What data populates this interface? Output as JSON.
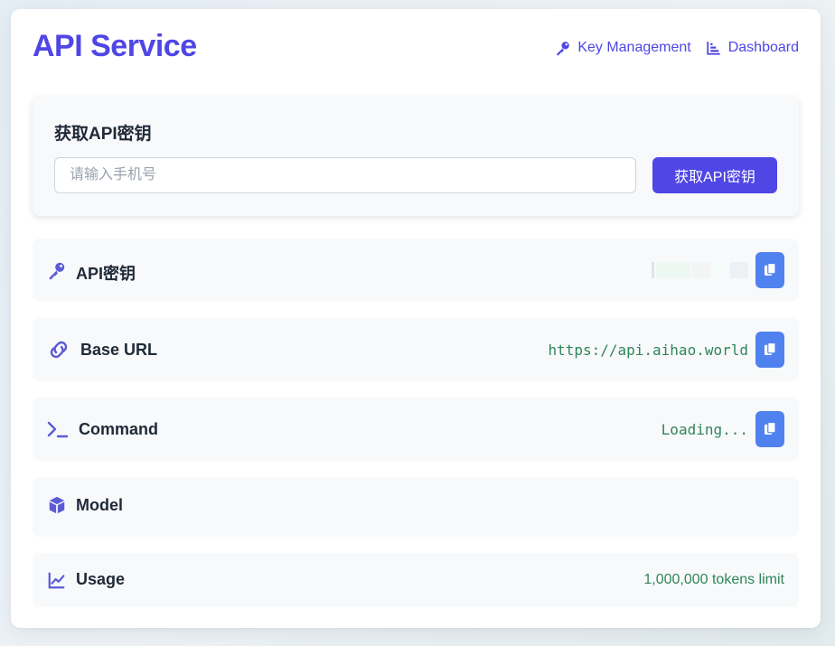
{
  "app": {
    "title": "API Service"
  },
  "nav": {
    "items": [
      {
        "label": "Key Management",
        "icon": "key-icon"
      },
      {
        "label": "Dashboard",
        "icon": "bar-chart-icon"
      }
    ]
  },
  "get_key": {
    "heading": "获取API密钥",
    "phone_placeholder": "请输入手机号",
    "phone_value": "",
    "button_label": "获取API密钥"
  },
  "rows": {
    "api_key": {
      "label": "API密钥",
      "icon": "key-icon",
      "value": ""
    },
    "base_url": {
      "label": "Base URL",
      "icon": "link-icon",
      "value": "https://api.aihao.world"
    },
    "command": {
      "label": "Command",
      "icon": "terminal-icon",
      "value": "Loading..."
    },
    "model": {
      "label": "Model",
      "icon": "cube-icon",
      "value": ""
    },
    "usage": {
      "label": "Usage",
      "icon": "line-chart-icon",
      "value": "1,000,000 tokens limit"
    }
  },
  "colors": {
    "accent": "#4f46e5",
    "copy_button": "#4f82ee",
    "value_text": "#2f855a",
    "icon": "#5b5bd6"
  }
}
